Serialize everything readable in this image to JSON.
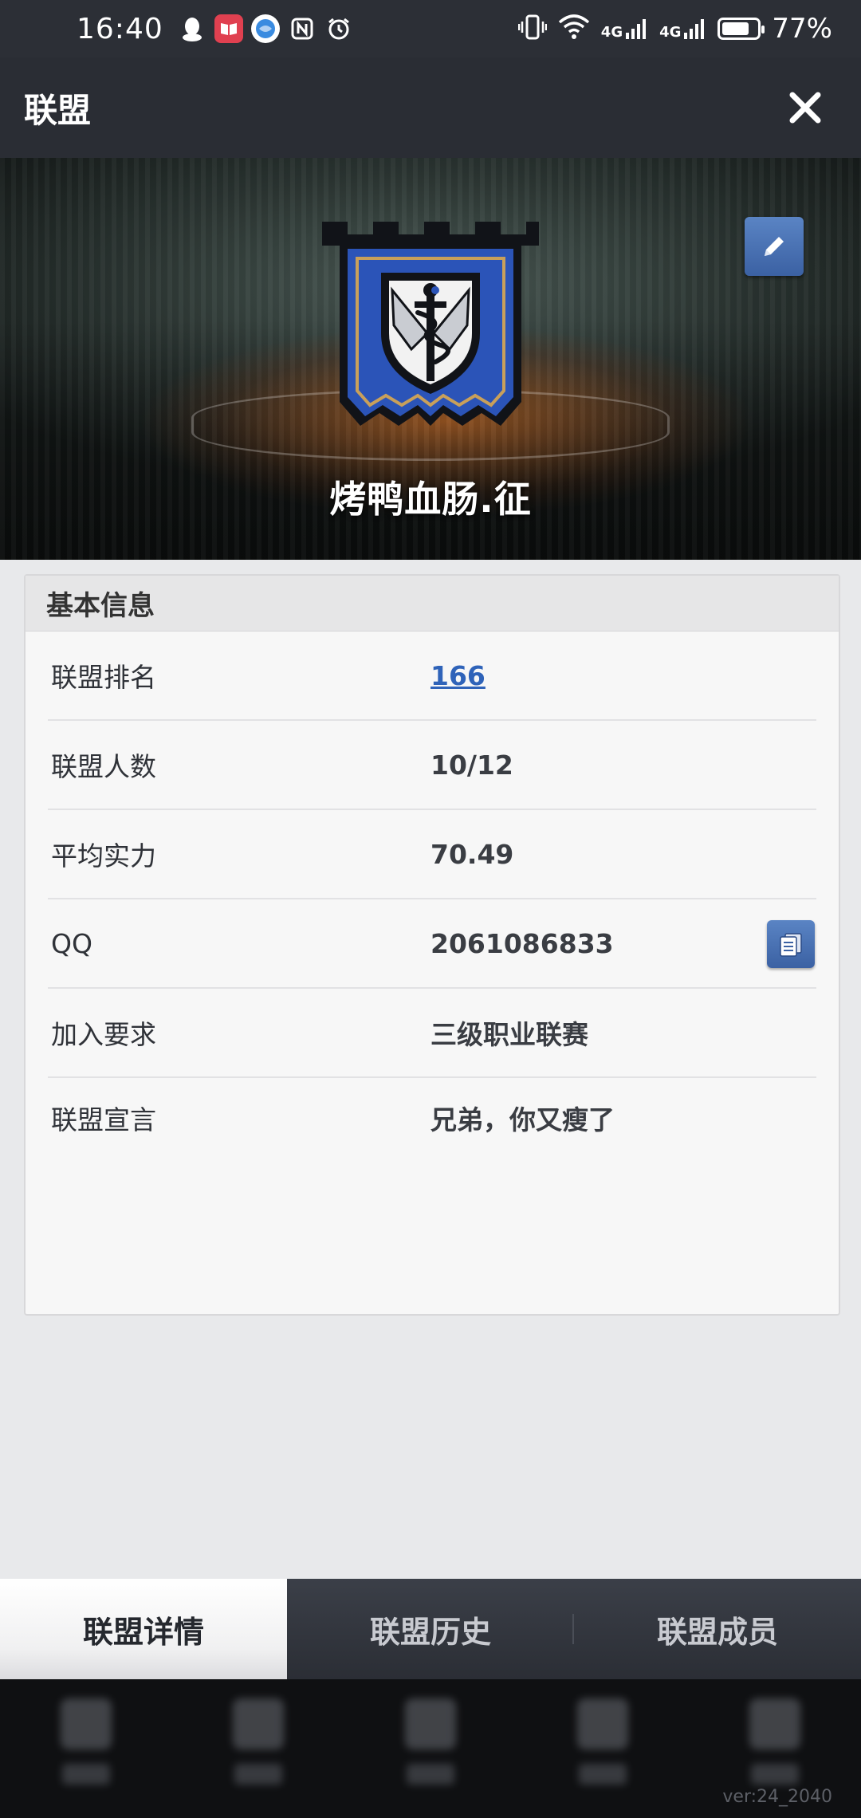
{
  "status_bar": {
    "time": "16:40",
    "battery": "77%",
    "battery_level": 0.77,
    "network_labels": [
      "4G",
      "4G"
    ]
  },
  "header": {
    "title": "联盟",
    "close_icon": "close-icon"
  },
  "banner": {
    "team_name": "烤鸭血肠.征"
  },
  "info": {
    "section_title": "基本信息",
    "rows": [
      {
        "label": "联盟排名",
        "value": "166"
      },
      {
        "label": "联盟人数",
        "value": "10/12"
      },
      {
        "label": "平均实力",
        "value": "70.49"
      },
      {
        "label": "QQ",
        "value": "2061086833"
      },
      {
        "label": "加入要求",
        "value": "三级职业联赛"
      },
      {
        "label": "联盟宣言",
        "value": "兄弟，你又瘦了"
      }
    ]
  },
  "tabs": [
    {
      "label": "联盟详情",
      "active": true
    },
    {
      "label": "联盟历史",
      "active": false
    },
    {
      "label": "联盟成员",
      "active": false
    }
  ],
  "footer": {
    "version": "ver:24_2040"
  },
  "colors": {
    "accent_blue": "#3b61a3",
    "link_blue": "#2f63b9",
    "header_bg": "#2a2d34"
  }
}
